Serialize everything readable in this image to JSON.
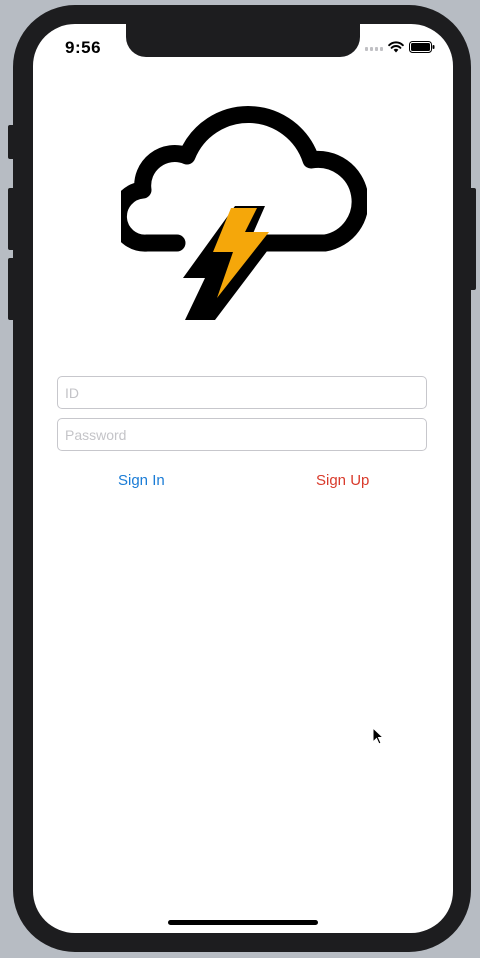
{
  "status_bar": {
    "time": "9:56"
  },
  "logo": {
    "icon": "thunderstorm-cloud-icon",
    "bolt_color": "#f5a70a"
  },
  "form": {
    "id_placeholder": "ID",
    "password_placeholder": "Password"
  },
  "actions": {
    "sign_in_label": "Sign In",
    "sign_up_label": "Sign Up",
    "sign_in_color": "#1a7cd6",
    "sign_up_color": "#d93a2b"
  }
}
